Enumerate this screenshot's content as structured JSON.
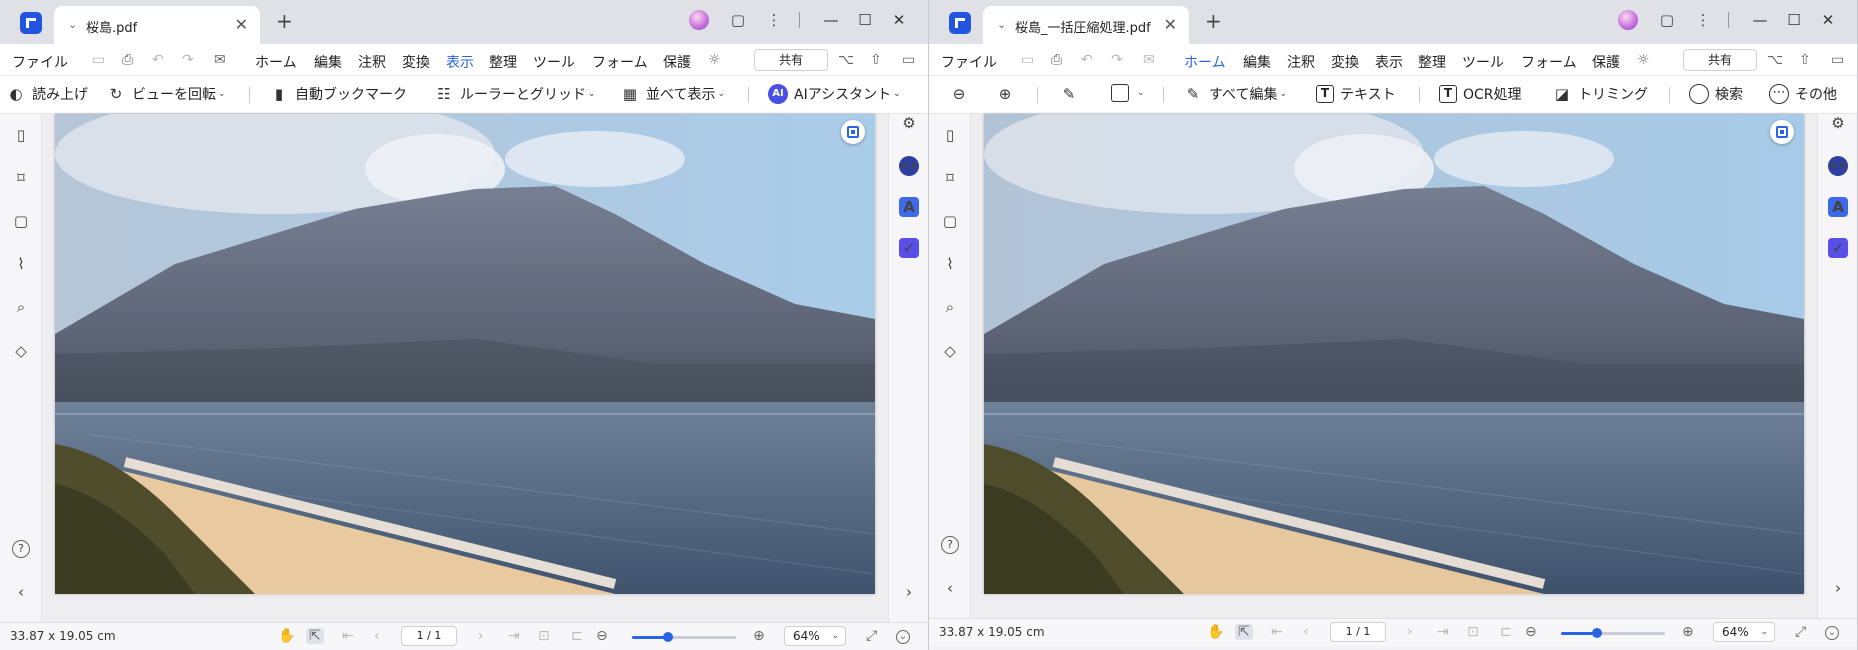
{
  "icons": {
    "tab_chevron": "⌄",
    "close": "✕",
    "new_tab": "+",
    "minimize": "—",
    "maximize": "☐",
    "save": "▭",
    "print": "⎙",
    "undo": "↶",
    "redo": "↷",
    "mail": "✉",
    "idea": "☼",
    "branch": "⌥",
    "upload": "⇧",
    "panel": "▭",
    "page": "▯",
    "bookmark": "⌑",
    "comment": "▢",
    "attachment": "⌇",
    "search": "⌕",
    "layers": "◇",
    "help": "?",
    "collapse_left": "‹",
    "expand_right": "›",
    "adjust": "⚙",
    "ai": "••",
    "translate": "A",
    "check": "✓",
    "hand": "✋",
    "cursor": "⇱",
    "first": "⇤",
    "prev": "‹",
    "next": "›",
    "last": "⇥",
    "crop": "⊡",
    "frame": "⊏",
    "zoom_out": "⊖",
    "zoom_in": "⊕",
    "fullscreen": "⤢",
    "more": "⌄",
    "reading_mode": "◐",
    "rotate": "↻",
    "bookmark_auto": "▮",
    "ruler": "☷",
    "layout": "▦",
    "highlighter": "✎",
    "edit": "✎",
    "text": "T",
    "ocr": "T",
    "trim": "◪",
    "search_tool": "◯",
    "more_tools": "⋯"
  },
  "colors": {
    "accent": "#2b63e6",
    "ai_badge": "#4a4fe6"
  },
  "left_window": {
    "tab_title": "桜島.pdf",
    "menu": {
      "file": "ファイル",
      "items": [
        "ホーム",
        "編集",
        "注釈",
        "変換",
        "表示",
        "整理",
        "ツール",
        "フォーム",
        "保護"
      ],
      "active_index": 4,
      "share": "共有"
    },
    "toolbar": {
      "read_aloud": "読み上げ",
      "rotate_view": "ビューを回転",
      "auto_bookmark": "自動ブックマーク",
      "ruler_grid": "ルーラーとグリッド",
      "side_by_side": "並べて表示",
      "ai_badge": "AI",
      "ai_assistant": "AIアシスタント"
    },
    "status": {
      "size": "33.87 x 19.05 cm",
      "page": "1 / 1",
      "zoom_level": 0.35,
      "zoom": "64%"
    }
  },
  "right_window": {
    "tab_title": "桜島_一括圧縮処理.pdf",
    "menu": {
      "file": "ファイル",
      "items": [
        "ホーム",
        "編集",
        "注釈",
        "変換",
        "表示",
        "整理",
        "ツール",
        "フォーム",
        "保護"
      ],
      "active_index": 0,
      "share": "共有"
    },
    "toolbar": {
      "edit_all": "すべて編集",
      "text": "テキスト",
      "ocr": "OCR処理",
      "trim": "トリミング",
      "search": "検索",
      "more": "その他"
    },
    "status": {
      "size": "33.87 x 19.05 cm",
      "page": "1 / 1",
      "zoom_level": 0.35,
      "zoom": "64%"
    }
  }
}
